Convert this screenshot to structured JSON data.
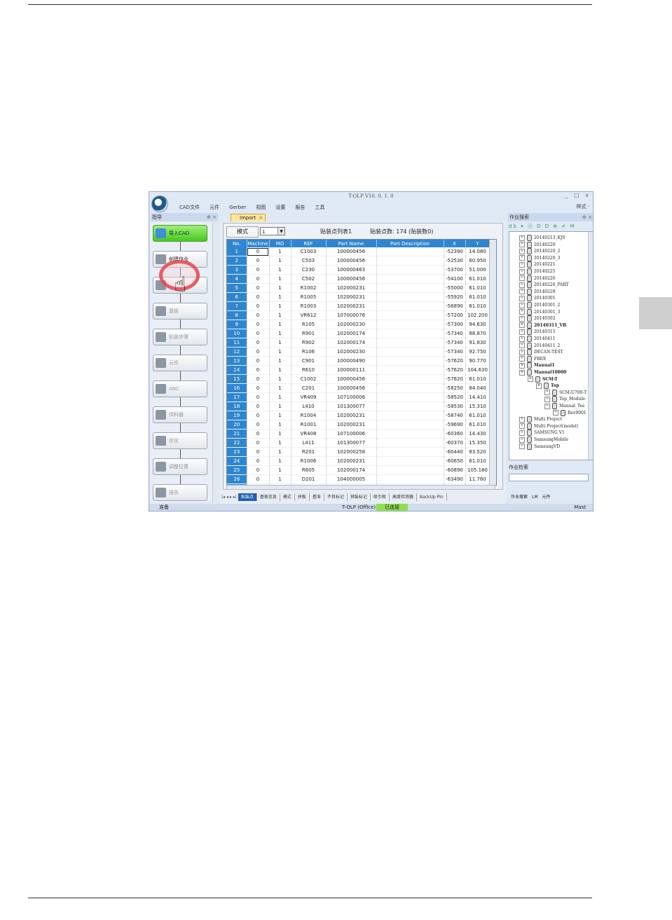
{
  "app": {
    "title": "T-OLP V10. 0. 1. 0",
    "window_controls": "_ □ x",
    "menu": [
      "CAD文件",
      "元件",
      "Gerber",
      "视图",
      "设置",
      "报告",
      "工具"
    ],
    "style_menu": "样式 ·"
  },
  "left_panel": {
    "title": "指导",
    "pin": "⊕ ×",
    "steps": [
      {
        "label": "导入CAD",
        "icon": "import-cad-icon",
        "state": "active"
      },
      {
        "label": "创建作业",
        "icon": "create-job-icon",
        "state": "current"
      },
      {
        "label": "",
        "icon": "edit-icon",
        "state": "disabled"
      },
      {
        "label": "基板",
        "icon": "board-icon",
        "state": "disabled"
      },
      {
        "label": "贴装步骤",
        "icon": "placement-step-icon",
        "state": "disabled"
      },
      {
        "label": "元件",
        "icon": "component-icon",
        "state": "disabled"
      },
      {
        "label": "ANC",
        "icon": "anc-icon",
        "state": "disabled"
      },
      {
        "label": "供料器",
        "icon": "feeder-icon",
        "state": "disabled"
      },
      {
        "label": "优化",
        "icon": "optimize-icon",
        "state": "disabled"
      },
      {
        "label": "调整位置",
        "icon": "adjust-position-icon",
        "state": "disabled"
      },
      {
        "label": "报告",
        "icon": "report-icon",
        "state": "disabled"
      }
    ]
  },
  "center": {
    "doc_tab": "Import",
    "mode_button": "模式",
    "mode_select": "1",
    "list_title": "贴装点列表1",
    "point_count": "贴装点数: 174 (贴装数0)",
    "columns": [
      "No.",
      "Machine",
      "MD",
      "REF",
      "Part Name",
      "Part Description",
      "X",
      "Y"
    ],
    "rows": [
      [
        "1",
        "0",
        "1",
        "C1003",
        "100000456",
        "",
        "-52390",
        "14.080"
      ],
      [
        "2",
        "0",
        "1",
        "C503",
        "100000456",
        "",
        "-52530",
        "60.950"
      ],
      [
        "3",
        "0",
        "1",
        "C230",
        "100000463",
        "",
        "-53700",
        "51.000"
      ],
      [
        "4",
        "0",
        "1",
        "C502",
        "100000456",
        "",
        "-54100",
        "61.010"
      ],
      [
        "5",
        "0",
        "1",
        "R1002",
        "102000231",
        "",
        "-55000",
        "61.010"
      ],
      [
        "6",
        "0",
        "1",
        "R1005",
        "102000231",
        "",
        "-55920",
        "61.010"
      ],
      [
        "7",
        "0",
        "1",
        "R1003",
        "102000231",
        "",
        "-56890",
        "61.010"
      ],
      [
        "8",
        "0",
        "1",
        "VR612",
        "107000076",
        "",
        "-57200",
        "102.200"
      ],
      [
        "9",
        "0",
        "1",
        "R105",
        "102000230",
        "",
        "-57300",
        "94.630"
      ],
      [
        "10",
        "0",
        "1",
        "R901",
        "102000174",
        "",
        "-57340",
        "88.870"
      ],
      [
        "11",
        "0",
        "1",
        "R902",
        "102000174",
        "",
        "-57340",
        "91.830"
      ],
      [
        "12",
        "0",
        "1",
        "R106",
        "102000230",
        "",
        "-57340",
        "92.750"
      ],
      [
        "13",
        "0",
        "1",
        "C901",
        "100000490",
        "",
        "-57620",
        "90.770"
      ],
      [
        "14",
        "0",
        "1",
        "R610",
        "100000111",
        "",
        "-57620",
        "104.630"
      ],
      [
        "15",
        "0",
        "1",
        "C1002",
        "100000456",
        "",
        "-57820",
        "61.010"
      ],
      [
        "16",
        "0",
        "1",
        "C201",
        "100000456",
        "",
        "-58250",
        "84.040"
      ],
      [
        "17",
        "0",
        "1",
        "VR409",
        "107100006",
        "",
        "-58520",
        "14.410"
      ],
      [
        "18",
        "0",
        "1",
        "L410",
        "101300077",
        "",
        "-58530",
        "15.310"
      ],
      [
        "19",
        "0",
        "1",
        "R1004",
        "102000231",
        "",
        "-58740",
        "61.010"
      ],
      [
        "20",
        "0",
        "1",
        "R1001",
        "102000231",
        "",
        "-59690",
        "61.010"
      ],
      [
        "21",
        "0",
        "1",
        "VR408",
        "107100006",
        "",
        "-60360",
        "14.430"
      ],
      [
        "22",
        "0",
        "1",
        "L411",
        "101300077",
        "",
        "-60370",
        "15.350"
      ],
      [
        "23",
        "0",
        "1",
        "R201",
        "102000258",
        "",
        "-60440",
        "83.520"
      ],
      [
        "24",
        "0",
        "1",
        "R1006",
        "102000231",
        "",
        "-60650",
        "61.010"
      ],
      [
        "25",
        "0",
        "1",
        "R605",
        "102000174",
        "",
        "-60890",
        "105.180"
      ],
      [
        "26",
        "0",
        "1",
        "D201",
        "104000005",
        "",
        "-63490",
        "11.760"
      ],
      [
        "27",
        "0",
        "1",
        "C229",
        "100000463",
        "",
        "-63590",
        "15.220"
      ]
    ],
    "sheet_nav": "|◂ ◂ ▸ ▸|",
    "sheet_tabs": [
      "贴装点",
      "基板信息",
      "模式",
      "拼板",
      "基准",
      "不良标记",
      "预装标记",
      "吸引吸",
      "高度检测器",
      "BackUp Pin"
    ]
  },
  "right_panel": {
    "title": "作业搜索",
    "pin": "⊕ ×",
    "toolbar": "db ▾ ⓞ D D ⊕ ✔ M",
    "tree": [
      {
        "label": "20140213_KJS",
        "level": 0,
        "bold": false
      },
      {
        "label": "20140220",
        "level": 0,
        "bold": false
      },
      {
        "label": "20140220_2",
        "level": 0,
        "bold": false
      },
      {
        "label": "20140220_3",
        "level": 0,
        "bold": false
      },
      {
        "label": "20140221",
        "level": 0,
        "bold": false
      },
      {
        "label": "20140225",
        "level": 0,
        "bold": false
      },
      {
        "label": "20140226",
        "level": 0,
        "bold": false
      },
      {
        "label": "20140226_PART",
        "level": 0,
        "bold": false
      },
      {
        "label": "20140228",
        "level": 0,
        "bold": false
      },
      {
        "label": "20140301",
        "level": 0,
        "bold": false
      },
      {
        "label": "20140301_2",
        "level": 0,
        "bold": false
      },
      {
        "label": "20140301_3",
        "level": 0,
        "bold": false
      },
      {
        "label": "20140302",
        "level": 0,
        "bold": false
      },
      {
        "label": "20140311_VB",
        "level": 0,
        "bold": true
      },
      {
        "label": "20140315",
        "level": 0,
        "bold": false
      },
      {
        "label": "20140411",
        "level": 0,
        "bold": false
      },
      {
        "label": "20140411_2",
        "level": 0,
        "bold": false
      },
      {
        "label": "DECAN-TEST",
        "level": 0,
        "bold": false
      },
      {
        "label": "FREE",
        "level": 0,
        "bold": false
      },
      {
        "label": "Manual1",
        "level": 0,
        "bold": true
      },
      {
        "label": "Manual10000",
        "level": 0,
        "bold": true
      },
      {
        "label": "SCM-T",
        "level": 1,
        "bold": true
      },
      {
        "label": "Top",
        "level": 2,
        "bold": true
      },
      {
        "label": "SCM-U700-T",
        "level": 3,
        "bold": false
      },
      {
        "label": "Top_Module",
        "level": 3,
        "bold": false
      },
      {
        "label": "Manual_Tes",
        "level": 3,
        "bold": false
      },
      {
        "label": "Rev0001",
        "level": 4,
        "bold": false
      },
      {
        "label": "Multi Project",
        "level": 0,
        "bold": false
      },
      {
        "label": "Multi Project(model)",
        "level": 0,
        "bold": false
      },
      {
        "label": "SAMSUNG V1",
        "level": 0,
        "bold": false
      },
      {
        "label": "SamsungMobile",
        "level": 0,
        "bold": false
      },
      {
        "label": "SamsungVD",
        "level": 0,
        "bold": false
      }
    ],
    "job_search_label": "作业检索",
    "bottom_tabs": [
      "作业搜索",
      "LM",
      "元件"
    ]
  },
  "status": {
    "ready": "准备",
    "app_label": "T-OLP (Office)",
    "connection": "已连接",
    "mode": "Mast"
  },
  "colors": {
    "header_blue": "#2f86d0",
    "active_step_green": "#46c81e",
    "highlight_ring": "#e63c46"
  }
}
